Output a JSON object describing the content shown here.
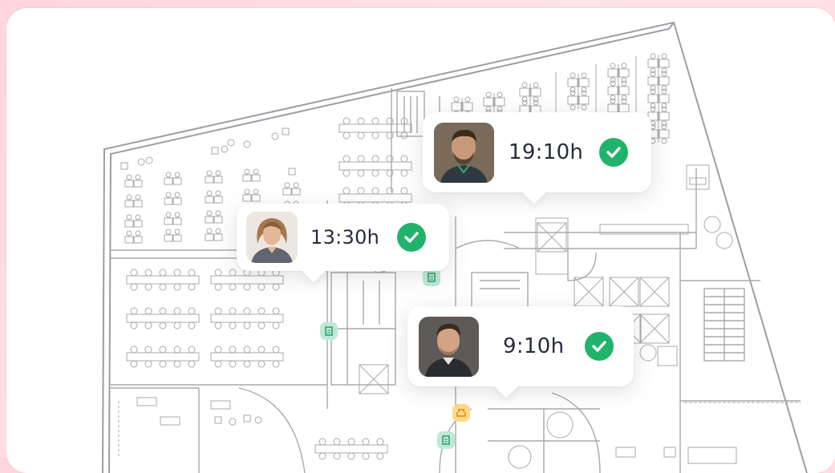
{
  "bookings": [
    {
      "name": "booking-card-1",
      "time": "19:10h",
      "status": "checked-in",
      "avatar": "man-beard-avatar"
    },
    {
      "name": "booking-card-2",
      "time": "13:30h",
      "status": "checked-in",
      "avatar": "woman-avatar"
    },
    {
      "name": "booking-card-3",
      "time": "9:10h",
      "status": "checked-in",
      "avatar": "man-avatar"
    }
  ],
  "colors": {
    "background": "#ffdbe1",
    "card": "#ffffff",
    "check": "#22b36b",
    "room_green": "#bfe9d6",
    "room_green_icon": "#2a9a6a",
    "room_orange": "#ffd98a",
    "room_orange_icon": "#d68a10",
    "plan_line": "#a9a9ae"
  },
  "icons": {
    "check": "check-circle-icon",
    "meeting_room": "door-icon",
    "lounge": "sofa-icon"
  }
}
